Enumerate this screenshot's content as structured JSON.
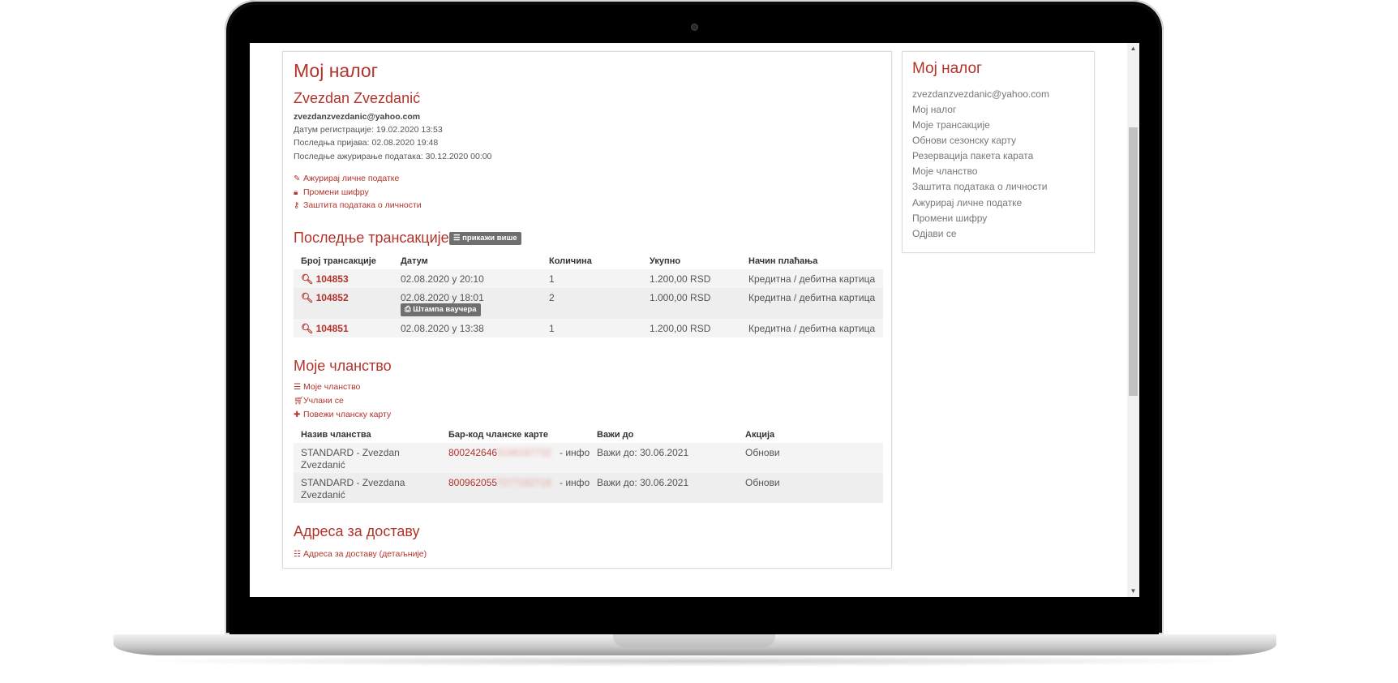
{
  "page": {
    "title": "Мој налог",
    "user_name": "Zvezdan Zvezdanić",
    "email": "zvezdanzvezdanic@yahoo.com",
    "registration": "Датум регистрације: 19.02.2020 13:53",
    "last_login": "Последња пријава: 02.08.2020 19:48",
    "last_update": "Последње ажурирање података: 30.12.2020 00:00",
    "actions": [
      {
        "label": "Ажурирај личне податке",
        "icon": "edit-icon"
      },
      {
        "label": "Промени шифру",
        "icon": "lock-icon"
      },
      {
        "label": "Заштита података о личности",
        "icon": "key-icon"
      }
    ]
  },
  "transactions": {
    "title": "Последње трансакције",
    "show_more": "прикажи више",
    "headers": [
      "Број трансакције",
      "Датум",
      "Количина",
      "Укупно",
      "Начин плаћања"
    ],
    "rows": [
      {
        "id": "104853",
        "date": "02.08.2020 у 20:10",
        "qty": "1",
        "total": "1.200,00 RSD",
        "payment": "Кредитна / дебитна картица"
      },
      {
        "id": "104852",
        "date": "02.08.2020 у 18:01",
        "qty": "2",
        "total": "1.000,00 RSD",
        "payment": "Кредитна / дебитна картица",
        "voucher": "Штампа ваучера"
      },
      {
        "id": "104851",
        "date": "02.08.2020 у 13:38",
        "qty": "1",
        "total": "1.200,00 RSD",
        "payment": "Кредитна / дебитна картица"
      }
    ]
  },
  "membership": {
    "title": "Моје чланство",
    "links": [
      {
        "label": "Моје чланство",
        "icon": "list-icon"
      },
      {
        "label": "Учлани се",
        "icon": "cart-icon"
      },
      {
        "label": "Повежи чланску карту",
        "icon": "plus-icon"
      }
    ],
    "headers": [
      "Назив чланства",
      "Бар-код чланске карте",
      "Важи до",
      "Акција"
    ],
    "rows": [
      {
        "name_line1": "STANDARD - Zvezdan",
        "name_line2": "Zvezdanić",
        "barcode": "800242646",
        "barcode_hidden": "3196167732",
        "info": "- инфо",
        "valid": "Важи до: 30.06.2021",
        "action": "Обнови"
      },
      {
        "name_line1": "STANDARD - Zvezdana",
        "name_line2": "Zvezdanić",
        "barcode": "800962055",
        "barcode_hidden": "7277182718",
        "info": "- инфо",
        "valid": "Важи до: 30.06.2021",
        "action": "Обнови"
      }
    ]
  },
  "delivery": {
    "title": "Адреса за доставу",
    "link": "Адреса за доставу (детаљније)"
  },
  "sidebar": {
    "title": "Мој налог",
    "items": [
      "zvezdanzvezdanic@yahoo.com",
      "Мој налог",
      "Моје трансакције",
      "Обнови сезонску карту",
      "Резервација пакета карата",
      "Моје чланство",
      "Заштита података о личности",
      "Ажурирај личне податке",
      "Промени шифру",
      "Одјави се"
    ]
  },
  "colors": {
    "accent": "#b3332b",
    "text": "#555555",
    "button": "#6f6f6f"
  }
}
